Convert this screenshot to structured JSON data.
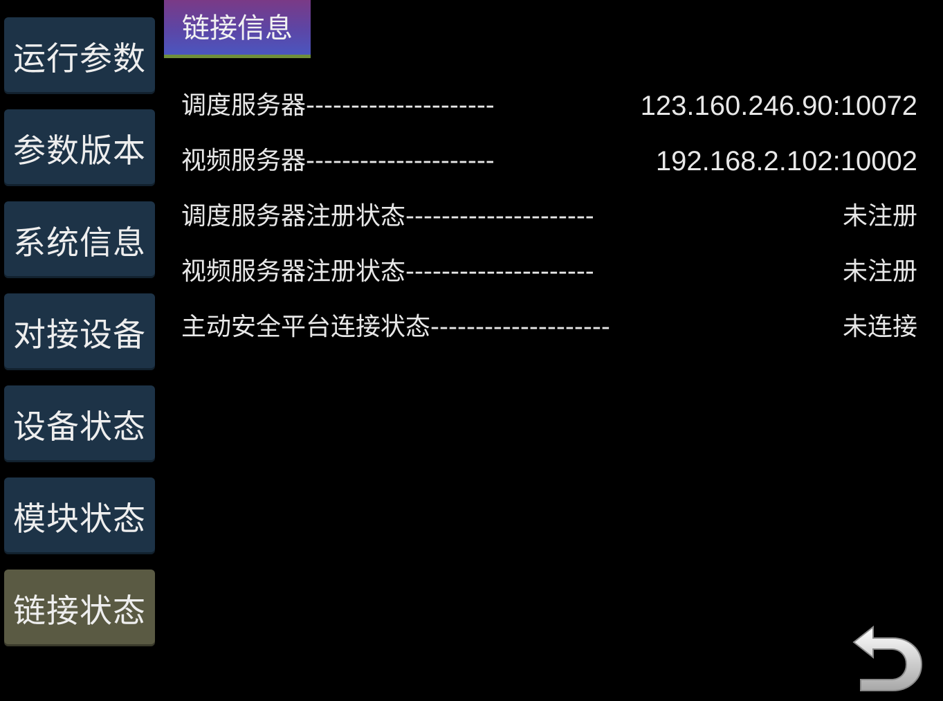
{
  "sidebar": {
    "items": [
      {
        "label": "运行参数",
        "active": false
      },
      {
        "label": "参数版本",
        "active": false
      },
      {
        "label": "系统信息",
        "active": false
      },
      {
        "label": "对接设备",
        "active": false
      },
      {
        "label": "设备状态",
        "active": false
      },
      {
        "label": "模块状态",
        "active": false
      },
      {
        "label": "链接状态",
        "active": true
      }
    ]
  },
  "tab": {
    "title": "链接信息"
  },
  "rows": [
    {
      "label": "调度服务器---------------------",
      "value": "123.160.246.90:10072"
    },
    {
      "label": "视频服务器---------------------",
      "value": "192.168.2.102:10002"
    },
    {
      "label": "调度服务器注册状态---------------------",
      "value": "未注册"
    },
    {
      "label": "视频服务器注册状态---------------------",
      "value": "未注册"
    },
    {
      "label": "主动安全平台连接状态--------------------",
      "value": "未连接"
    }
  ],
  "back_button": {
    "icon": "back-arrow-icon"
  },
  "colors": {
    "background": "#000000",
    "nav_button": "#1d3347",
    "nav_button_active": "#5a5a43",
    "tab_gradient_top": "#7a3a86",
    "tab_gradient_bottom": "#4b56bf",
    "tab_underline": "#6f8f3a"
  }
}
